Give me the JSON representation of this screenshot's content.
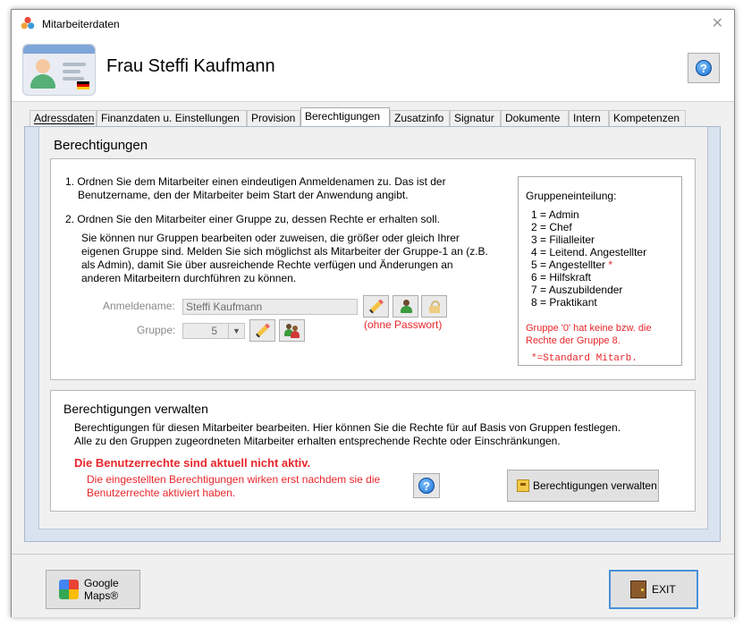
{
  "window": {
    "title": "Mitarbeiterdaten"
  },
  "header": {
    "employee_name": "Frau Steffi Kaufmann",
    "help_label": "?"
  },
  "tabs": [
    {
      "label": "Adressdaten",
      "underline": "A"
    },
    {
      "label": "Finanzdaten u. Einstellungen"
    },
    {
      "label": "Provision"
    },
    {
      "label": "Berechtigungen",
      "active": true
    },
    {
      "label": "Zusatzinfo"
    },
    {
      "label": "Signatur"
    },
    {
      "label": "Dokumente"
    },
    {
      "label": "Intern"
    },
    {
      "label": "Kompetenzen"
    }
  ],
  "permissions": {
    "title": "Berechtigungen",
    "step1_line1": "1. Ordnen Sie dem Mitarbeiter einen eindeutigen Anmeldenamen zu. Das ist der",
    "step1_line2": "Benutzername, den der Mitarbeiter beim Start der Anwendung angibt.",
    "step2": "2. Ordnen Sie den Mitarbeiter einer Gruppe zu, dessen Rechte er erhalten soll.",
    "note_lines": [
      "Sie können nur Gruppen bearbeiten oder zuweisen, die größer oder gleich Ihrer",
      "eigenen Gruppe sind. Melden Sie sich möglichst als Mitarbeiter der Gruppe-1 an (z.B.",
      "als Admin), damit Sie über ausreichende Rechte verfügen und Änderungen an",
      "anderen Mitarbeitern durchführen zu können."
    ],
    "login_label": "Anmeldename:",
    "login_value": "Steffi Kaufmann",
    "group_label": "Gruppe:",
    "group_value": "5",
    "no_password": "(ohne Passwort)",
    "legend": {
      "title": "Gruppeneinteilung:",
      "items": [
        "1 = Admin",
        "2 = Chef",
        "3 = Filialleiter",
        "4 = Leitend. Angestellter",
        "5 = Angestellter",
        "6 = Hilfskraft",
        "7 = Auszubildender",
        "8 = Praktikant"
      ],
      "star": "*",
      "note_line1": "Gruppe '0' hat keine bzw. die",
      "note_line2": "Rechte der Gruppe 8.",
      "standard": "*=Standard Mitarb."
    }
  },
  "manage": {
    "title": "Berechtigungen verwalten",
    "desc_line1": "Berechtigungen für diesen Mitarbeiter bearbeiten. Hier können Sie die Rechte für auf Basis von Gruppen festlegen.",
    "desc_line2": "Alle zu den Gruppen zugeordneten Mitarbeiter erhalten entsprechende Rechte oder Einschränkungen.",
    "warning": "Die Benutzerrechte sind aktuell nicht aktiv.",
    "warning_detail_line1": "Die eingestellten Berechtigungen wirken erst nachdem sie die",
    "warning_detail_line2": "Benutzerrechte aktiviert haben.",
    "manage_button": "Berechtigungen verwalten",
    "help_label": "?"
  },
  "footer": {
    "google_line1": "Google",
    "google_line2": "Maps®",
    "exit_label": "EXIT"
  },
  "colors": {
    "accent_red": "#e8262b",
    "panel_blue": "#d9e3ef"
  }
}
